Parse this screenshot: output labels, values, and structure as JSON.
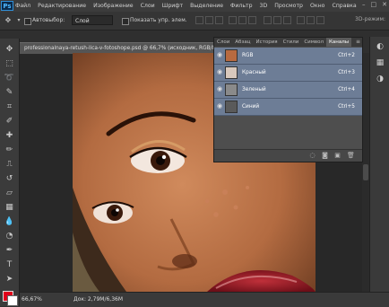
{
  "app": {
    "logo": "Ps",
    "menu": [
      "Файл",
      "Редактирование",
      "Изображение",
      "Слои",
      "Шрифт",
      "Выделение",
      "Фильтр",
      "3D",
      "Просмотр",
      "Окно",
      "Справка"
    ],
    "window_controls": [
      "–",
      "□",
      "✕"
    ]
  },
  "options_bar": {
    "auto_select_label": "Автовыбор:",
    "auto_select_value": "Слой",
    "show_controls_label": "Показать упр. элем.",
    "mode_3d_label": "3D-режим:"
  },
  "document": {
    "tab_title": "professionalnaya-retush-lica-v-fotoshope.psd @ 66,7% (исходник, RGB/8) *",
    "zoom": "66,67%",
    "doc_size": "Док: 2,79M/6,36M"
  },
  "panel": {
    "tabs": [
      "Слои",
      "Абзац",
      "История",
      "Стили",
      "Символ",
      "Каналы"
    ],
    "active_tab": "Каналы",
    "menu_icon": "≡",
    "channels": [
      {
        "name": "RGB",
        "shortcut": "Ctrl+2",
        "thumb_color": "#b86a40"
      },
      {
        "name": "Красный",
        "shortcut": "Ctrl+3",
        "thumb_color": "#d8c8bc"
      },
      {
        "name": "Зеленый",
        "shortcut": "Ctrl+4",
        "thumb_color": "#8a8a8a"
      },
      {
        "name": "Синий",
        "shortcut": "Ctrl+5",
        "thumb_color": "#5a5a5a"
      }
    ]
  },
  "colors": {
    "foreground": "#e0001b",
    "background": "#ffffff",
    "channel_selected": "#6d7d96"
  }
}
